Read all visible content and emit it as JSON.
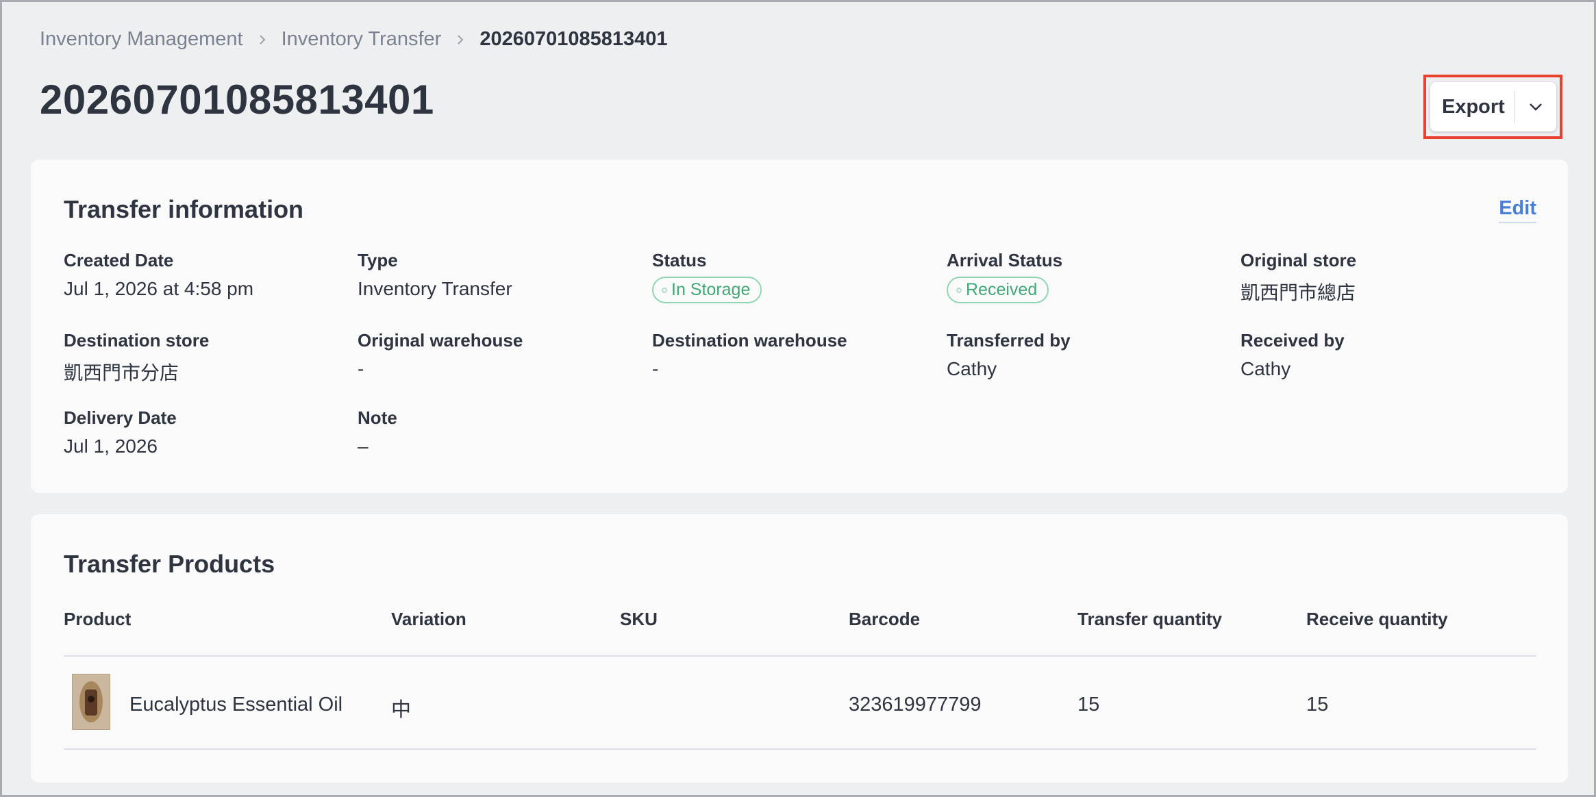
{
  "breadcrumb": {
    "item1": "Inventory Management",
    "item2": "Inventory Transfer",
    "current": "20260701085813401"
  },
  "page_title": "20260701085813401",
  "export": {
    "label": "Export",
    "icon": "chevron-down-icon"
  },
  "info": {
    "title": "Transfer information",
    "edit_label": "Edit",
    "fields": {
      "created_date": {
        "label": "Created Date",
        "value": "Jul 1, 2026 at 4:58 pm"
      },
      "type": {
        "label": "Type",
        "value": "Inventory Transfer"
      },
      "status": {
        "label": "Status",
        "value": "In Storage"
      },
      "arrival_status": {
        "label": "Arrival Status",
        "value": "Received"
      },
      "original_store": {
        "label": "Original store",
        "value": "凱西門市總店"
      },
      "destination_store": {
        "label": "Destination store",
        "value": "凱西門市分店"
      },
      "original_warehouse": {
        "label": "Original warehouse",
        "value": "-"
      },
      "destination_warehouse": {
        "label": "Destination warehouse",
        "value": "-"
      },
      "transferred_by": {
        "label": "Transferred by",
        "value": "Cathy"
      },
      "received_by": {
        "label": "Received by",
        "value": "Cathy"
      },
      "delivery_date": {
        "label": "Delivery Date",
        "value": "Jul 1, 2026"
      },
      "note": {
        "label": "Note",
        "value": "–"
      }
    },
    "colors": {
      "badge_green": "#3fa876",
      "link_blue": "#4a7fd6"
    }
  },
  "products": {
    "title": "Transfer Products",
    "columns": [
      "Product",
      "Variation",
      "SKU",
      "Barcode",
      "Transfer quantity",
      "Receive quantity"
    ],
    "rows": [
      {
        "product": "Eucalyptus Essential Oil",
        "variation": "中",
        "sku": "",
        "barcode": "323619977799",
        "transfer_quantity": "15",
        "receive_quantity": "15"
      }
    ]
  }
}
